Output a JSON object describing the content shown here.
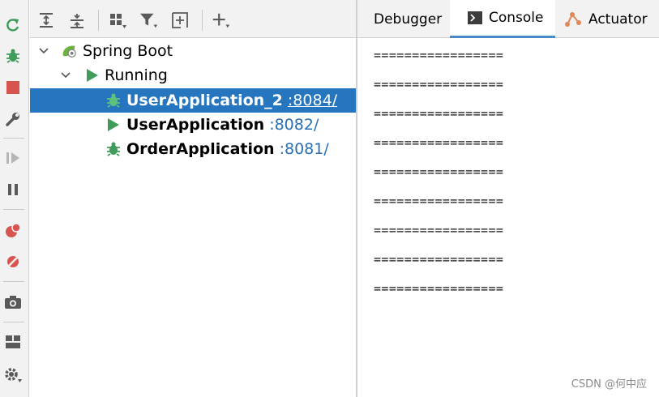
{
  "left_toolbar": {
    "icons": [
      "rerun-icon",
      "debug-icon",
      "stop-icon",
      "wrench-icon",
      "resume-icon",
      "pause-icon",
      "breakpoints-icon",
      "mute-breakpoints-icon",
      "camera-icon",
      "layout-icon",
      "settings-icon"
    ]
  },
  "tree_toolbar": {
    "icons": [
      "expand-all-icon",
      "collapse-all-icon",
      "group-icon",
      "filter-icon",
      "add-service-icon",
      "plus-icon"
    ]
  },
  "tree": {
    "root": "Spring Boot",
    "group": "Running",
    "apps": [
      {
        "name": "UserApplication_2",
        "port": ":8084/",
        "selected": true,
        "icon": "debug-bug-icon"
      },
      {
        "name": "UserApplication",
        "port": ":8082/",
        "selected": false,
        "icon": "run-triangle-icon"
      },
      {
        "name": "OrderApplication",
        "port": ":8081/",
        "selected": false,
        "icon": "debug-bug-icon"
      }
    ]
  },
  "tabs": {
    "debugger": "Debugger",
    "console": "Console",
    "actuator": "Actuator",
    "active": "Console"
  },
  "console": {
    "lines": [
      "=================",
      "=================",
      "=================",
      "=================",
      "=================",
      "=================",
      "=================",
      "=================",
      "================="
    ]
  },
  "watermark": "CSDN @何中应",
  "colors": {
    "selection": "#2675bf",
    "port_link": "#2a6fb4",
    "run_green": "#3f9c5b",
    "stop_red": "#d9534f"
  }
}
